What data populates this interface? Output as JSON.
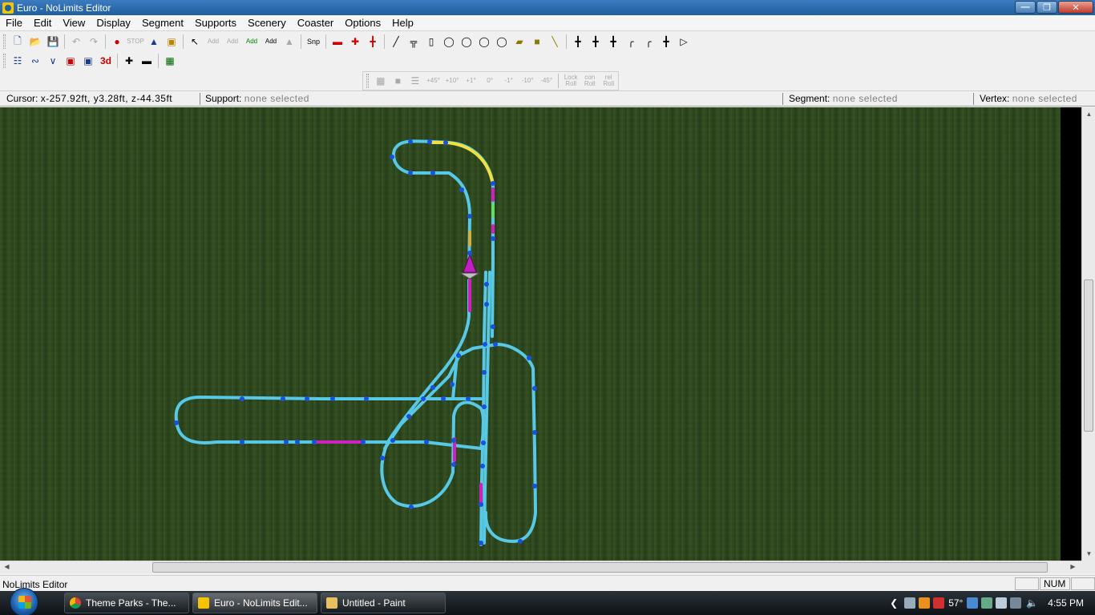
{
  "window": {
    "title": "Euro - NoLimits Editor"
  },
  "menu": [
    "File",
    "Edit",
    "View",
    "Display",
    "Segment",
    "Supports",
    "Scenery",
    "Coaster",
    "Options",
    "Help"
  ],
  "toolbar": {
    "snap_label": "Snp",
    "add1": "Add",
    "add2": "Add",
    "add3": "Add",
    "add4": "Add",
    "stop": "STOP",
    "threed": "3d",
    "angles": [
      "+45°",
      "+10°",
      "+1°",
      "0°",
      "-1°",
      "-10°",
      "-45°"
    ],
    "lock_roll": "Lock Roll",
    "con_roll": "con Roll",
    "rel_roll": "rel Roll"
  },
  "info": {
    "cursor_label": "Cursor:",
    "cursor_value": "x-257.92ft, y3.28ft, z-44.35ft",
    "support_label": "Support:",
    "support_value": "none selected",
    "segment_label": "Segment:",
    "segment_value": "none selected",
    "vertex_label": "Vertex:",
    "vertex_value": "none selected"
  },
  "status": {
    "text": "NoLimits Editor",
    "num": "NUM"
  },
  "taskbar": {
    "items": [
      "Theme Parks - The...",
      "Euro - NoLimits Edit...",
      "Untitled - Paint"
    ],
    "temp": "57°",
    "clock": "4:55 PM"
  },
  "colors": {
    "track": "#5ad0f0",
    "node": "#1a50e0",
    "highlight_yellow": "#f0e040",
    "highlight_magenta": "#d020c0",
    "grass": "#2f4a1e",
    "titlebar": "#2a6db0"
  }
}
